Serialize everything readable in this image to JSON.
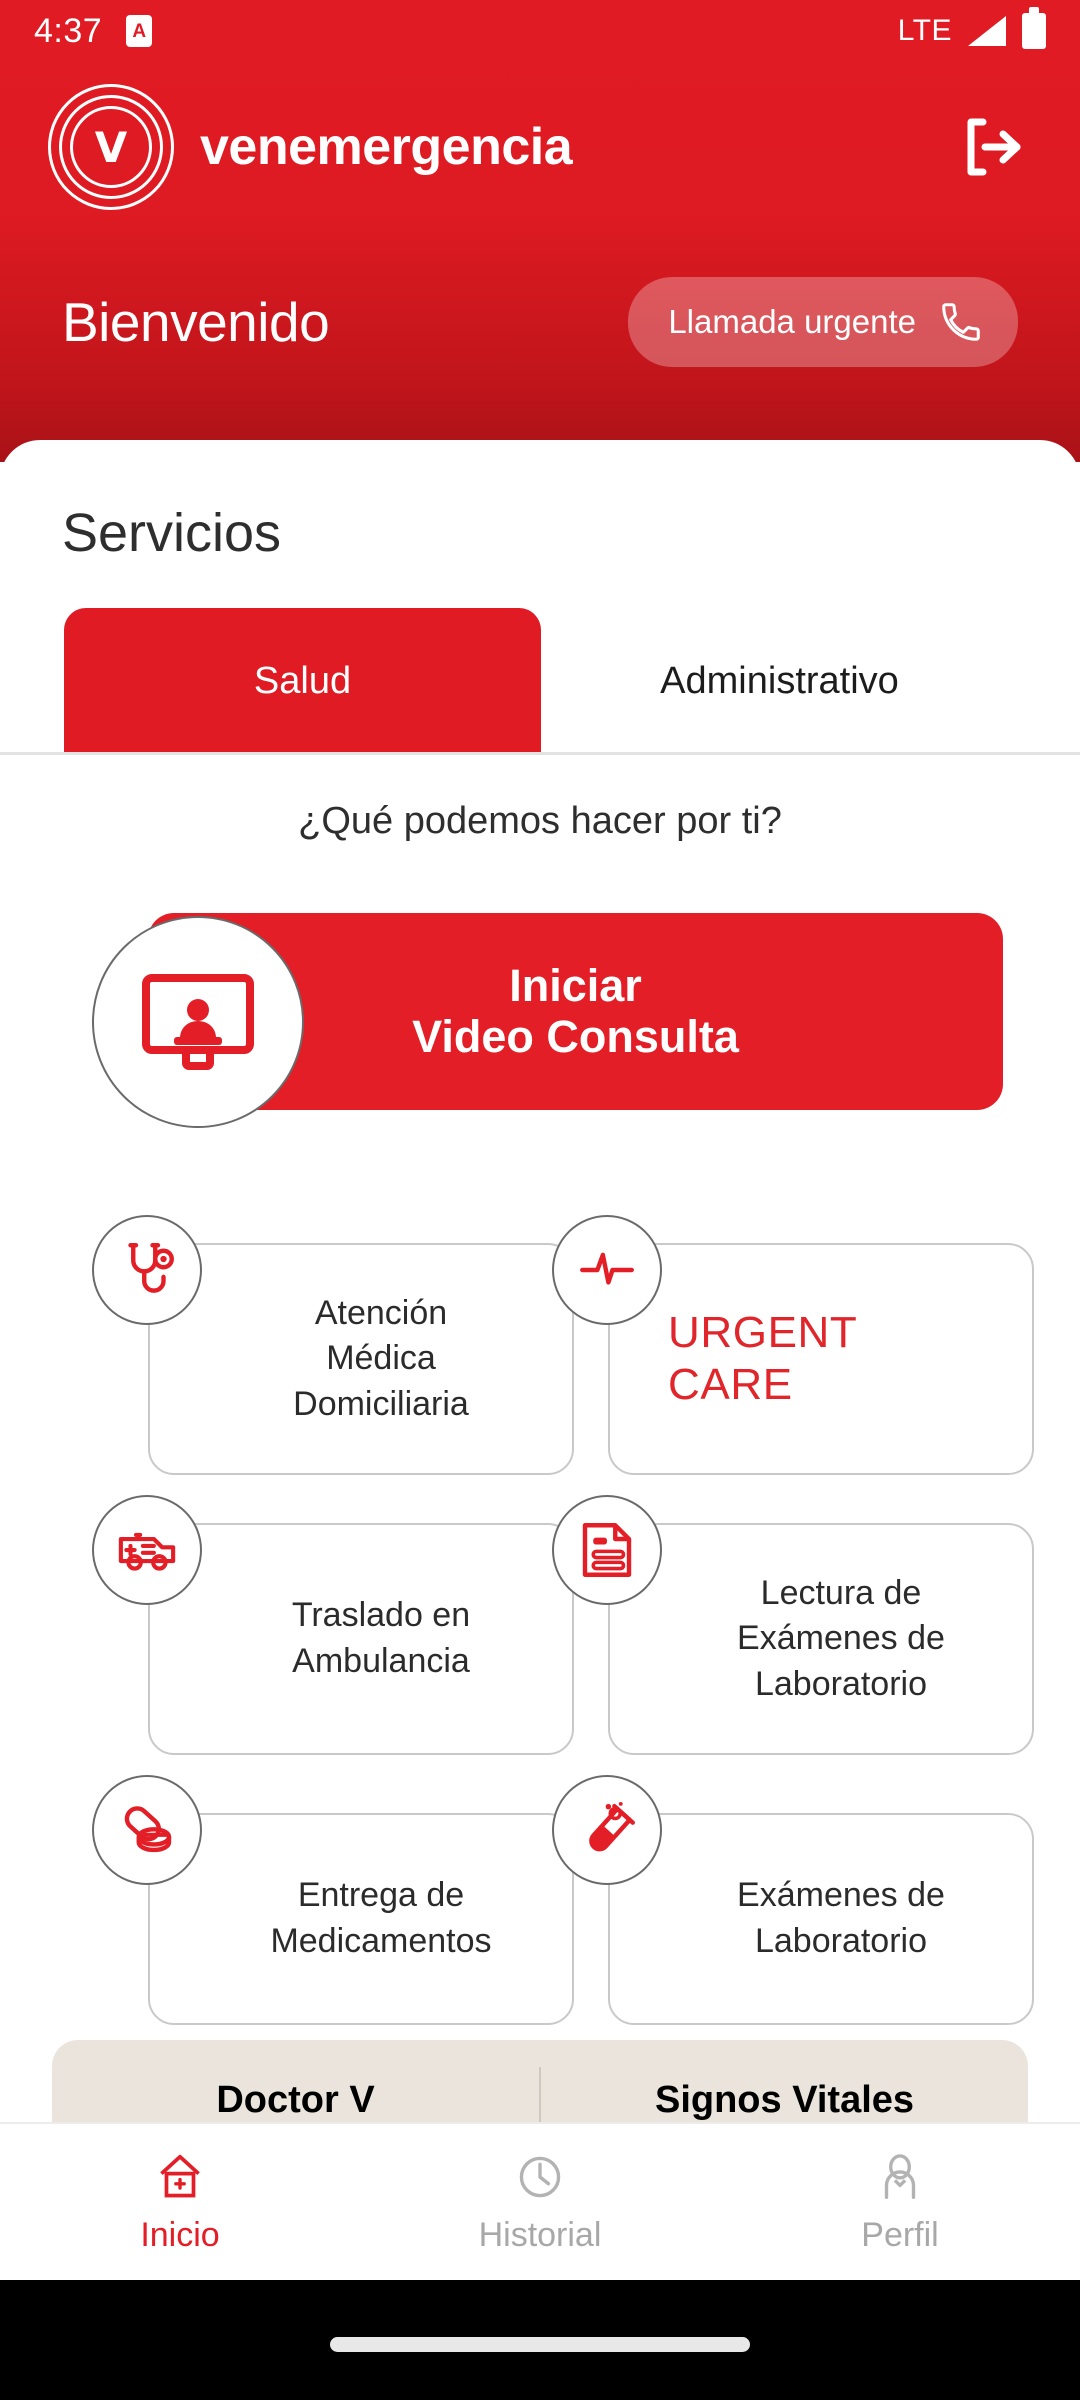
{
  "statusbar": {
    "time": "4:37",
    "app_badge": "A",
    "network": "LTE",
    "signal_icon": "signal-bars-icon",
    "battery_icon": "battery-full-icon"
  },
  "header": {
    "brand": "venemergencia",
    "logo_letter": "V",
    "logo_icon": "venemergencia-logo-icon",
    "logout_icon": "logout-icon",
    "welcome": "Bienvenido",
    "urgent_call": {
      "label": "Llamada urgente",
      "icon": "phone-icon"
    }
  },
  "services": {
    "title": "Servicios",
    "tabs": [
      {
        "label": "Salud",
        "active": true
      },
      {
        "label": "Administrativo",
        "active": false
      }
    ],
    "question": "¿Qué podemos hacer por ti?",
    "video_consult": {
      "line1": "Iniciar",
      "line2": "Video Consulta",
      "icon": "video-monitor-person-icon"
    },
    "items": [
      {
        "label": "Atención\nMédica\nDomiciliaria",
        "icon": "stethoscope-icon",
        "style": "normal"
      },
      {
        "label": "URGENT\nCARE",
        "icon": "heartbeat-icon",
        "style": "urgent"
      },
      {
        "label": "Traslado en\nAmbulancia",
        "icon": "ambulance-icon",
        "style": "normal"
      },
      {
        "label": "Lectura de\nExámenes de\nLaboratorio",
        "icon": "document-lines-icon",
        "style": "normal"
      },
      {
        "label": "Entrega de\nMedicamentos",
        "icon": "pills-icon",
        "style": "normal"
      },
      {
        "label": "Exámenes de\nLaboratorio",
        "icon": "test-tube-icon",
        "style": "normal"
      }
    ]
  },
  "banner": {
    "left": "Doctor V",
    "right": "Signos Vitales"
  },
  "bottom_nav": [
    {
      "label": "Inicio",
      "icon": "home-medical-icon",
      "active": true
    },
    {
      "label": "Historial",
      "icon": "clock-icon",
      "active": false
    },
    {
      "label": "Perfil",
      "icon": "person-icon",
      "active": false
    }
  ],
  "colors": {
    "brand_red": "#E01B24",
    "accent_red": "#E31E26",
    "banner_beige": "#EAE4DC",
    "muted_gray": "#a8a8a8"
  }
}
